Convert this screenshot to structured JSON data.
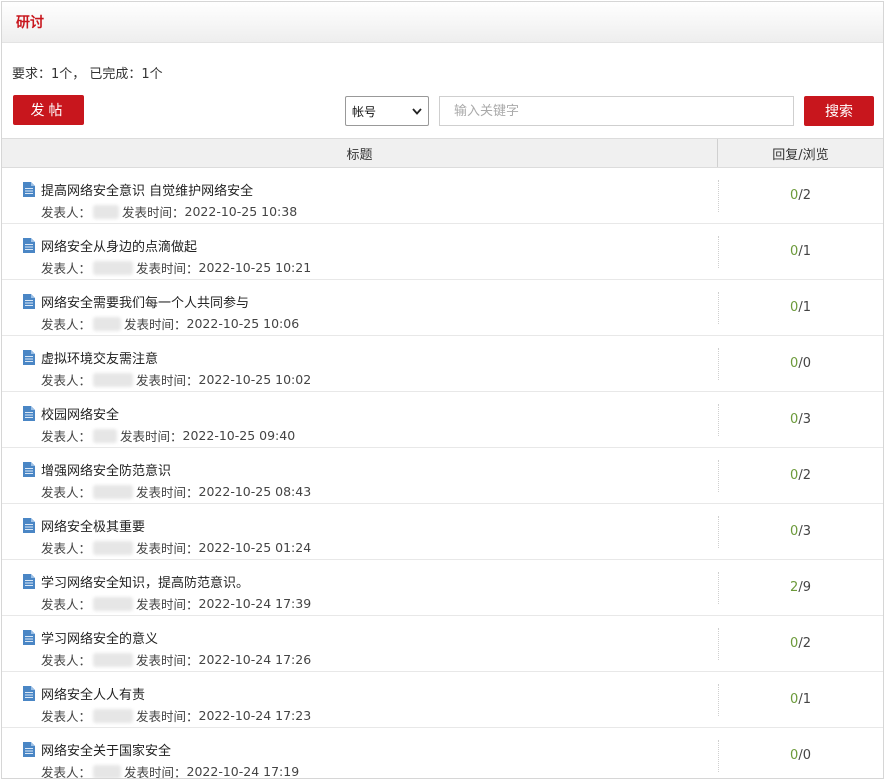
{
  "header": {
    "title": "研讨"
  },
  "requirement": {
    "text": "要求：1个，  已完成：1个"
  },
  "toolbar": {
    "post_label": "发帖",
    "select_value": "帐号",
    "search_placeholder": "输入关键字",
    "search_label": "搜索"
  },
  "table": {
    "col_title": "标题",
    "col_stats": "回复/浏览",
    "author_label": "发表人：",
    "time_label": "发表时间：",
    "rows": [
      {
        "title": "提高网络安全意识 自觉维护网络安全",
        "time": "2022-10-25 10:38",
        "replies": "0",
        "views": "/2"
      },
      {
        "title": "网络安全从身边的点滴做起",
        "time": "2022-10-25 10:21",
        "replies": "0",
        "views": "/1"
      },
      {
        "title": "网络安全需要我们每一个人共同参与",
        "time": "2022-10-25 10:06",
        "replies": "0",
        "views": "/1"
      },
      {
        "title": "虚拟环境交友需注意",
        "time": "2022-10-25 10:02",
        "replies": "0",
        "views": "/0"
      },
      {
        "title": "校园网络安全",
        "time": "2022-10-25 09:40",
        "replies": "0",
        "views": "/3"
      },
      {
        "title": "增强网络安全防范意识",
        "time": "2022-10-25 08:43",
        "replies": "0",
        "views": "/2"
      },
      {
        "title": "网络安全极其重要",
        "time": "2022-10-25 01:24",
        "replies": "0",
        "views": "/3"
      },
      {
        "title": "学习网络安全知识，提高防范意识。",
        "time": "2022-10-24 17:39",
        "replies": "2",
        "views": "/9"
      },
      {
        "title": "学习网络安全的意义",
        "time": "2022-10-24 17:26",
        "replies": "0",
        "views": "/2"
      },
      {
        "title": "网络安全人人有责",
        "time": "2022-10-24 17:23",
        "replies": "0",
        "views": "/1"
      },
      {
        "title": "网络安全关于国家安全",
        "time": "2022-10-24 17:19",
        "replies": "0",
        "views": "/0"
      }
    ]
  },
  "colors": {
    "accent": "#c8161d",
    "reply_green": "#6c9a3a",
    "icon_blue": "#4a86c5"
  }
}
